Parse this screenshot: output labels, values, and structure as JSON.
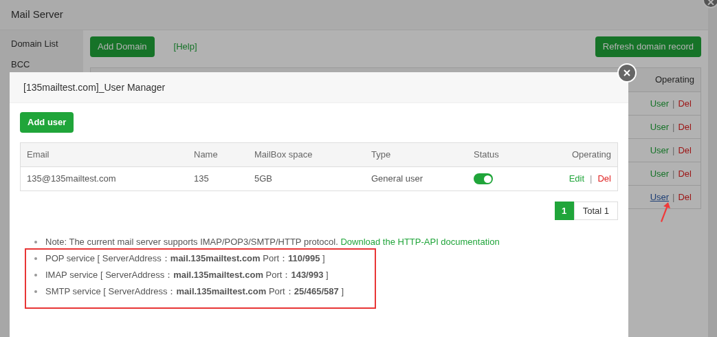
{
  "background_window": {
    "title": "Mail Server",
    "sidebar": [
      {
        "label": "Domain List"
      },
      {
        "label": "BCC"
      }
    ],
    "add_button": "Add Domain",
    "help_link": "[Help]",
    "refresh_button": "Refresh domain record",
    "table": {
      "operating_header": "Operating",
      "rows": [
        {
          "user": "User",
          "separator": "|",
          "del": "Del",
          "hovered": false
        },
        {
          "user": "User",
          "separator": "|",
          "del": "Del",
          "hovered": false
        },
        {
          "user": "User",
          "separator": "|",
          "del": "Del",
          "hovered": false
        },
        {
          "user": "User",
          "separator": "|",
          "del": "Del",
          "hovered": false
        },
        {
          "user": "User",
          "separator": "|",
          "del": "Del",
          "hovered": true
        }
      ]
    }
  },
  "dialog": {
    "title": "[135mailtest.com]_User Manager",
    "add_button": "Add user",
    "columns": [
      "Email",
      "Name",
      "MailBox space",
      "Type",
      "Status",
      "Operating"
    ],
    "rows": [
      {
        "email": "135@135mailtest.com",
        "name": "135",
        "space": "5GB",
        "type": "General user",
        "status_on": true,
        "edit": "Edit",
        "separator": "|",
        "del": "Del"
      }
    ],
    "pagination": {
      "pages": [
        {
          "label": "1",
          "selected": true
        }
      ],
      "total": "Total 1"
    },
    "notes": [
      {
        "kind": "note",
        "text": "Note: The current mail server supports IMAP/POP3/SMTP/HTTP protocol.",
        "link": "Download the HTTP-API documentation"
      },
      {
        "kind": "service",
        "text": "POP service [ ServerAddress：**mail.135mailtest.com** Port：**110/995** ]"
      },
      {
        "kind": "service",
        "text": "IMAP service [ ServerAddress：**mail.135mailtest.com** Port：**143/993** ]"
      },
      {
        "kind": "service",
        "text": "SMTP service [ ServerAddress：**mail.135mailtest.com** Port：**25/465/587** ]"
      }
    ]
  }
}
